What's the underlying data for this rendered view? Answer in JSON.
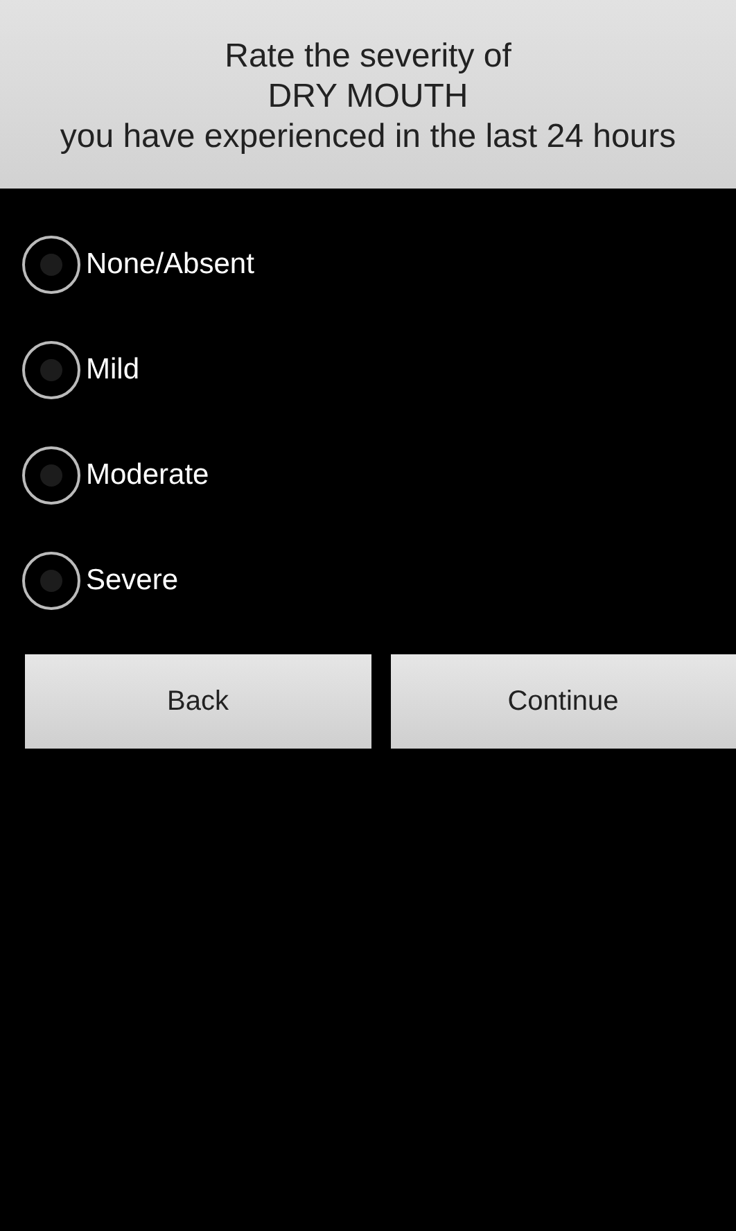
{
  "header": {
    "lines": [
      "Rate the severity of",
      "DRY MOUTH",
      "you have experienced in the last 24 hours"
    ]
  },
  "options": [
    {
      "label": "None/Absent",
      "selected": false
    },
    {
      "label": "Mild",
      "selected": false
    },
    {
      "label": "Moderate",
      "selected": false
    },
    {
      "label": "Severe",
      "selected": false
    }
  ],
  "buttons": [
    "Back",
    "Continue"
  ]
}
